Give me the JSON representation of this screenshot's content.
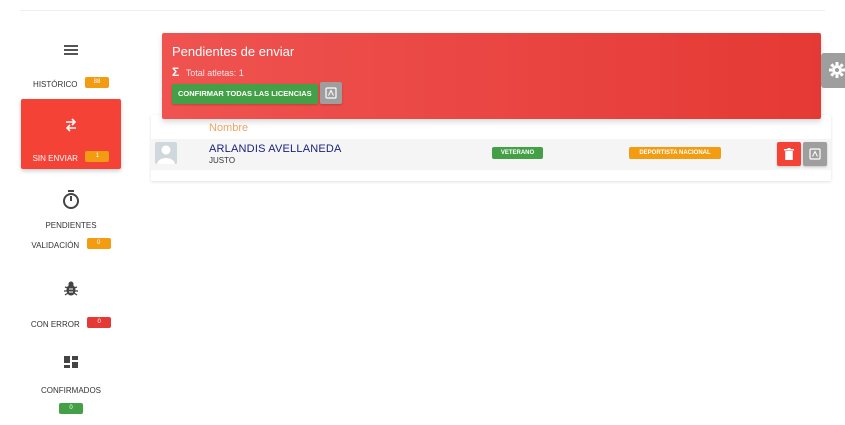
{
  "sidebar": {
    "items": [
      {
        "label": "HISTÓRICO",
        "badge": "88",
        "icon": "list-icon",
        "badge_color": "#f39c12"
      },
      {
        "label": "SIN ENVIAR",
        "badge": "1",
        "icon": "swap-arrows-icon",
        "badge_color": "#f39c12",
        "active": true
      },
      {
        "label_line1": "PENDIENTES",
        "label_line2": "VALIDACIÓN",
        "badge": "0",
        "icon": "stopwatch-icon",
        "badge_color": "#f39c12"
      },
      {
        "label": "CON ERROR",
        "badge": "0",
        "icon": "bug-icon",
        "badge_color": "#e53935"
      },
      {
        "label": "CONFIRMADOS",
        "badge": "0",
        "icon": "dashboard-icon",
        "badge_color": "#43a047"
      }
    ]
  },
  "header_card": {
    "title": "Pendientes de enviar",
    "sigma": "Σ",
    "total_text": "Total atletas: 1",
    "confirm_label": "CONFIRMAR TODAS LAS LICENCIAS",
    "pdf_icon": "pdf-icon",
    "color": "#e53935"
  },
  "settings_icon": "gear-icon",
  "table": {
    "column_header": "Nombre",
    "rows": [
      {
        "name": "ARLANDIS AVELLANEDA",
        "surname": "JUSTO",
        "tag1": "VETERANO",
        "tag2": "DEPORTISTA NACIONAL",
        "delete_icon": "trash-icon",
        "pdf_icon": "pdf-icon"
      }
    ]
  }
}
